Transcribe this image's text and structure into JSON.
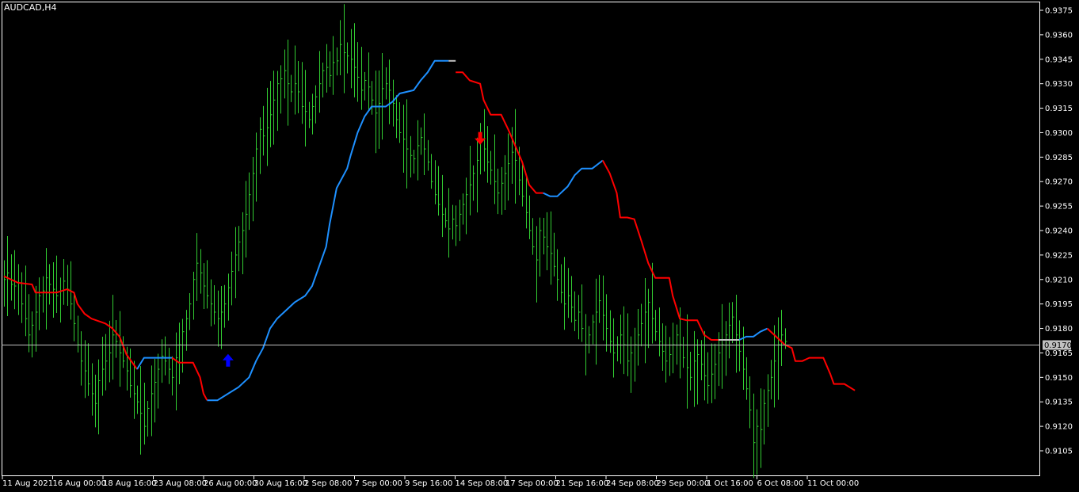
{
  "window": {
    "title": "AUDCAD,H4",
    "current_price": "0.9170"
  },
  "colors": {
    "background": "#000000",
    "frame": "#ffffff",
    "bars": "#32cd32",
    "trend_up": "#1e90ff",
    "trend_down": "#ff0000",
    "trend_flat": "#c0c0c0",
    "price_line": "#c0c0c0",
    "price_label_bg": "#c0c0c0",
    "arrow_up": "#0000ff",
    "arrow_down": "#ff0000"
  },
  "chart_data": {
    "type": "line",
    "title": "AUDCAD,H4",
    "symbol": "AUDCAD",
    "timeframe": "H4",
    "y_axis": {
      "side": "right",
      "range": [
        0.9094,
        0.9381
      ],
      "ticks": [
        "0.9375",
        "0.9360",
        "0.9345",
        "0.9330",
        "0.9315",
        "0.9300",
        "0.9285",
        "0.9270",
        "0.9255",
        "0.9240",
        "0.9225",
        "0.9210",
        "0.9195",
        "0.9180",
        "0.9165",
        "0.9150",
        "0.9135",
        "0.9120",
        "0.9105"
      ]
    },
    "x_axis": {
      "ticks": [
        "11 Aug 2021",
        "16 Aug 00:00",
        "18 Aug 16:00",
        "23 Aug 08:00",
        "26 Aug 00:00",
        "30 Aug 16:00",
        "2 Sep 08:00",
        "7 Sep 00:00",
        "9 Sep 16:00",
        "14 Sep 08:00",
        "17 Sep 00:00",
        "21 Sep 16:00",
        "24 Sep 08:00",
        "29 Sep 00:00",
        "1 Oct 16:00",
        "6 Oct 08:00",
        "11 Oct 00:00"
      ]
    },
    "current_price": 0.917,
    "close_series": [
      0.921,
      0.9214,
      0.9207,
      0.9206,
      0.9208,
      0.9195,
      0.9186,
      0.9176,
      0.9182,
      0.919,
      0.92,
      0.9203,
      0.9211,
      0.9207,
      0.9204,
      0.92,
      0.9203,
      0.9209,
      0.9204,
      0.9195,
      0.9183,
      0.917,
      0.916,
      0.9154,
      0.9146,
      0.914,
      0.9134,
      0.9148,
      0.9155,
      0.916,
      0.9165,
      0.9176,
      0.9172,
      0.9165,
      0.916,
      0.9154,
      0.9145,
      0.914,
      0.9135,
      0.9128,
      0.912,
      0.9131,
      0.914,
      0.9147,
      0.9155,
      0.9163,
      0.916,
      0.9155,
      0.915,
      0.9162,
      0.917,
      0.9178,
      0.9186,
      0.9195,
      0.921,
      0.922,
      0.9214,
      0.9206,
      0.92,
      0.9195,
      0.919,
      0.9186,
      0.919,
      0.9195,
      0.9205,
      0.9215,
      0.9225,
      0.9233,
      0.924,
      0.925,
      0.9262,
      0.9275,
      0.929,
      0.9302,
      0.9298,
      0.9303,
      0.9311,
      0.932,
      0.933,
      0.9333,
      0.9338,
      0.933,
      0.9325,
      0.933,
      0.9325,
      0.9316,
      0.9313,
      0.9308,
      0.9316,
      0.9322,
      0.933,
      0.9338,
      0.934,
      0.9335,
      0.9343,
      0.9344,
      0.9354,
      0.9349,
      0.9347,
      0.9345,
      0.934,
      0.9334,
      0.9326,
      0.9332,
      0.9328,
      0.932,
      0.9312,
      0.9318,
      0.9327,
      0.933,
      0.9326,
      0.9318,
      0.9308,
      0.93,
      0.9296,
      0.929,
      0.9286,
      0.9284,
      0.9292,
      0.9297,
      0.929,
      0.9282,
      0.927,
      0.9262,
      0.9256,
      0.925,
      0.9246,
      0.9241,
      0.9247,
      0.9243,
      0.925,
      0.9256,
      0.9262,
      0.9268,
      0.9275,
      0.9283,
      0.93,
      0.929,
      0.9282,
      0.9277,
      0.927,
      0.9263,
      0.9269,
      0.9275,
      0.9281,
      0.9288,
      0.9283,
      0.9271,
      0.9261,
      0.9251,
      0.924,
      0.923,
      0.9222,
      0.924,
      0.9236,
      0.923,
      0.9226,
      0.9218,
      0.921,
      0.9202,
      0.9195,
      0.92,
      0.9193,
      0.9185,
      0.919,
      0.918,
      0.917,
      0.9176,
      0.9184,
      0.919,
      0.9197,
      0.9188,
      0.918,
      0.9172,
      0.9165,
      0.917,
      0.9176,
      0.917,
      0.916,
      0.9165,
      0.917,
      0.9176,
      0.9183,
      0.919,
      0.9196,
      0.9186,
      0.9178,
      0.9172,
      0.9166,
      0.916,
      0.9164,
      0.917,
      0.9176,
      0.917,
      0.9162,
      0.9156,
      0.915,
      0.916,
      0.9164,
      0.9158,
      0.9151,
      0.9145,
      0.9152,
      0.9158,
      0.9165,
      0.917,
      0.9176,
      0.9182,
      0.9187,
      0.9176,
      0.9166,
      0.9155,
      0.9143,
      0.913,
      0.911,
      0.912,
      0.9118,
      0.9134,
      0.9142,
      0.915,
      0.916,
      0.917,
      0.9176,
      0.9172
    ],
    "trend_line": [
      {
        "state": "down",
        "points": [
          [
            0,
            0.9212
          ],
          [
            4,
            0.9208
          ],
          [
            8,
            0.9207
          ],
          [
            9,
            0.9202
          ],
          [
            15,
            0.9202
          ],
          [
            18,
            0.9204
          ],
          [
            20,
            0.9202
          ],
          [
            21,
            0.9195
          ],
          [
            23,
            0.9189
          ],
          [
            25,
            0.9186
          ],
          [
            29,
            0.9183
          ],
          [
            31,
            0.918
          ],
          [
            33,
            0.9175
          ],
          [
            35,
            0.9164
          ],
          [
            38,
            0.9155
          ]
        ]
      },
      {
        "state": "up",
        "points": [
          [
            38,
            0.9155
          ],
          [
            40,
            0.9162
          ],
          [
            44,
            0.9162
          ],
          [
            48,
            0.9162
          ]
        ]
      },
      {
        "state": "down",
        "points": [
          [
            48,
            0.9162
          ],
          [
            50,
            0.9159
          ],
          [
            54,
            0.9159
          ],
          [
            56,
            0.915
          ],
          [
            57,
            0.914
          ],
          [
            58,
            0.9136
          ]
        ]
      },
      {
        "state": "up",
        "points": [
          [
            58,
            0.9136
          ],
          [
            61,
            0.9136
          ],
          [
            64,
            0.914
          ],
          [
            67,
            0.9144
          ],
          [
            70,
            0.915
          ],
          [
            72,
            0.916
          ],
          [
            74,
            0.9168
          ],
          [
            76,
            0.918
          ],
          [
            78,
            0.9186
          ],
          [
            80,
            0.919
          ],
          [
            83,
            0.9196
          ],
          [
            86,
            0.92
          ],
          [
            88,
            0.9206
          ],
          [
            90,
            0.9218
          ],
          [
            92,
            0.923
          ],
          [
            93,
            0.9244
          ],
          [
            95,
            0.9266
          ],
          [
            98,
            0.9278
          ],
          [
            99,
            0.9286
          ],
          [
            101,
            0.93
          ],
          [
            103,
            0.931
          ],
          [
            105,
            0.9316
          ],
          [
            109,
            0.9316
          ],
          [
            111,
            0.9319
          ],
          [
            113,
            0.9324
          ],
          [
            117,
            0.9326
          ],
          [
            119,
            0.9332
          ],
          [
            121,
            0.9337
          ],
          [
            123,
            0.9344
          ],
          [
            127,
            0.9344
          ]
        ]
      },
      {
        "state": "flat",
        "points": [
          [
            127,
            0.9344
          ],
          [
            129,
            0.9344
          ]
        ]
      },
      {
        "state": "down",
        "points": [
          [
            129,
            0.9337
          ],
          [
            131,
            0.9337
          ],
          [
            133,
            0.9332
          ],
          [
            136,
            0.933
          ],
          [
            137,
            0.932
          ],
          [
            139,
            0.9311
          ],
          [
            142,
            0.9311
          ],
          [
            144,
            0.9302
          ],
          [
            146,
            0.9292
          ],
          [
            148,
            0.9282
          ],
          [
            150,
            0.9268
          ],
          [
            152,
            0.9263
          ],
          [
            154,
            0.9263
          ]
        ]
      },
      {
        "state": "up",
        "points": [
          [
            154,
            0.9263
          ],
          [
            156,
            0.9261
          ],
          [
            158,
            0.9261
          ],
          [
            161,
            0.9267
          ],
          [
            163,
            0.9274
          ],
          [
            165,
            0.9278
          ],
          [
            168,
            0.9278
          ],
          [
            171,
            0.9283
          ]
        ]
      },
      {
        "state": "down",
        "points": [
          [
            171,
            0.9283
          ],
          [
            173,
            0.9275
          ],
          [
            175,
            0.9263
          ],
          [
            176,
            0.9248
          ],
          [
            178,
            0.9248
          ],
          [
            180,
            0.9247
          ],
          [
            182,
            0.9234
          ],
          [
            184,
            0.922
          ],
          [
            186,
            0.9211
          ],
          [
            190,
            0.9211
          ],
          [
            191,
            0.92
          ],
          [
            193,
            0.9186
          ],
          [
            195,
            0.9185
          ],
          [
            198,
            0.9185
          ],
          [
            200,
            0.9176
          ],
          [
            202,
            0.9173
          ],
          [
            204,
            0.9173
          ]
        ]
      },
      {
        "state": "flat",
        "points": [
          [
            204,
            0.9173
          ],
          [
            210,
            0.9173
          ]
        ]
      },
      {
        "state": "up",
        "points": [
          [
            210,
            0.9173
          ],
          [
            212,
            0.9175
          ],
          [
            214,
            0.9175
          ],
          [
            216,
            0.9178
          ],
          [
            218,
            0.918
          ]
        ]
      },
      {
        "state": "down",
        "points": [
          [
            218,
            0.918
          ],
          [
            221,
            0.9174
          ],
          [
            223,
            0.917
          ],
          [
            225,
            0.9168
          ],
          [
            226,
            0.916
          ],
          [
            228,
            0.916
          ],
          [
            230,
            0.9162
          ],
          [
            234,
            0.9162
          ],
          [
            236,
            0.9152
          ],
          [
            237,
            0.9146
          ],
          [
            240,
            0.9146
          ],
          [
            243,
            0.9142
          ]
        ]
      }
    ],
    "signals": [
      {
        "type": "buy",
        "index": 64,
        "price": 0.916
      },
      {
        "type": "sell",
        "index": 136,
        "price": 0.9297
      }
    ]
  }
}
